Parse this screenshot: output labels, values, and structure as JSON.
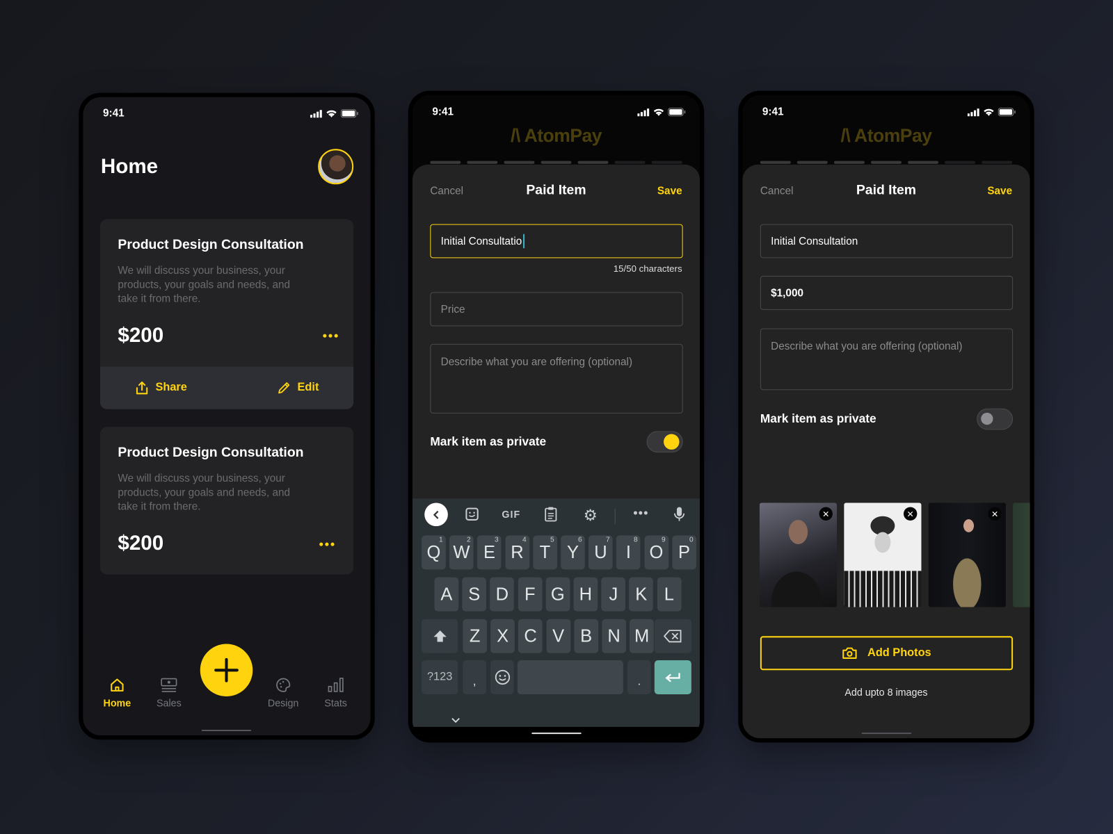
{
  "status": {
    "time": "9:41"
  },
  "colors": {
    "accent": "#ffd40f",
    "screen_bg": "#17171b",
    "card_bg": "#232325",
    "sheet_bg": "#232323",
    "keyboard_bg": "#2b3236",
    "enter_key": "#67aea5"
  },
  "home": {
    "title": "Home",
    "cards": [
      {
        "title": "Product Design Consultation",
        "description": "We will discuss your business, your products, your goals and needs, and take it from there.",
        "price": "$200",
        "share_label": "Share",
        "edit_label": "Edit"
      },
      {
        "title": "Product Design Consultation",
        "description": "We will discuss your business, your products, your goals and needs, and take it from there.",
        "price": "$200"
      }
    ],
    "nav": [
      {
        "label": "Home",
        "icon": "home-icon",
        "active": true
      },
      {
        "label": "Sales",
        "icon": "cash-icon",
        "active": false
      },
      {
        "label": "Design",
        "icon": "palette-icon",
        "active": false
      },
      {
        "label": "Stats",
        "icon": "bar-chart-icon",
        "active": false
      }
    ],
    "fab_icon": "plus-icon"
  },
  "brand": {
    "logo": "/\\ AtomPay"
  },
  "step_progress": {
    "completed": 5,
    "total": 7
  },
  "form_editing": {
    "cancel_label": "Cancel",
    "title": "Paid Item",
    "save_label": "Save",
    "name_value": "Initial Consultatio",
    "char_counter": "15/50 characters",
    "price_placeholder": "Price",
    "description_placeholder": "Describe what you are offering (optional)",
    "private_label": "Mark item as private",
    "private_on": true
  },
  "keyboard": {
    "toolbar": [
      "back-icon",
      "sticker-icon",
      "GIF",
      "clipboard-icon",
      "settings-icon",
      "more-icon",
      "mic-icon"
    ],
    "row1": [
      [
        "Q",
        "1"
      ],
      [
        "W",
        "2"
      ],
      [
        "E",
        "3"
      ],
      [
        "R",
        "4"
      ],
      [
        "T",
        "5"
      ],
      [
        "Y",
        "6"
      ],
      [
        "U",
        "7"
      ],
      [
        "I",
        "8"
      ],
      [
        "O",
        "9"
      ],
      [
        "P",
        "0"
      ]
    ],
    "row2": [
      "A",
      "S",
      "D",
      "F",
      "G",
      "H",
      "J",
      "K",
      "L"
    ],
    "row3": [
      "Z",
      "X",
      "C",
      "V",
      "B",
      "N",
      "M"
    ],
    "symbols_label": "?123",
    "comma": ",",
    "period": "."
  },
  "form_filled": {
    "cancel_label": "Cancel",
    "title": "Paid Item",
    "save_label": "Save",
    "name_value": "Initial Consultation",
    "price_value": "$1,000",
    "description_placeholder": "Describe what you are offering (optional)",
    "private_label": "Mark item as private",
    "private_on": false,
    "photo_count": 4,
    "add_photos_label": "Add Photos",
    "hint": "Add upto 8 images"
  }
}
